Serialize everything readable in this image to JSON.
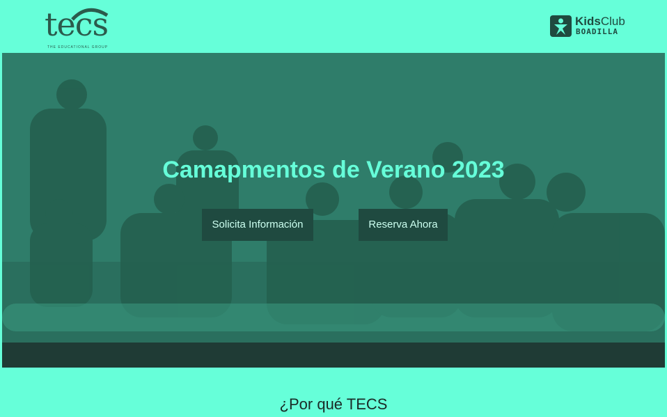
{
  "header": {
    "tecs_logo": {
      "word": "tecs",
      "tagline": "THE EDUCATIONAL GROUP"
    },
    "kids_logo": {
      "line1_bold": "Kids",
      "line1_rest": "Club",
      "line2": "BOADILLA"
    }
  },
  "hero": {
    "title": "Camapmentos de Verano 2023",
    "buttons": {
      "info_label": "Solicita Información",
      "reserve_label": "Reserva Ahora"
    }
  },
  "section": {
    "title": "¿Por qué TECS"
  },
  "colors": {
    "background": "#66ffd9",
    "hero_tint": "#2d7a68",
    "accent": "#66ffd9",
    "button_bg": "#1f4a40"
  }
}
